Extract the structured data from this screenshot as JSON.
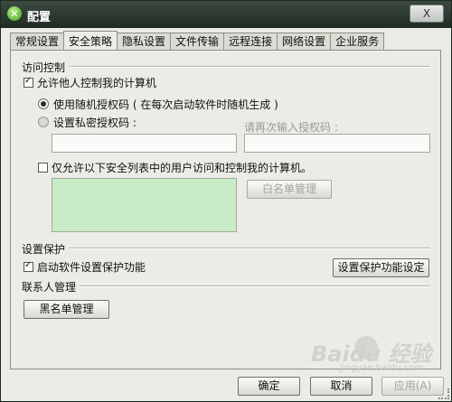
{
  "window": {
    "title": "配置",
    "close_label": "X"
  },
  "tabs": [
    {
      "label": "常规设置",
      "active": false
    },
    {
      "label": "安全策略",
      "active": true
    },
    {
      "label": "隐私设置",
      "active": false
    },
    {
      "label": "文件传输",
      "active": false
    },
    {
      "label": "远程连接",
      "active": false
    },
    {
      "label": "网络设置",
      "active": false
    },
    {
      "label": "企业服务",
      "active": false
    }
  ],
  "access_control": {
    "group_label": "访问控制",
    "allow_control": {
      "label": "允许他人控制我的计算机",
      "checked": true
    },
    "random_code": {
      "label": "使用随机授权码 ( 在每次启动软件时随机生成 )",
      "selected": true
    },
    "private_code": {
      "label": "设置私密授权码 :",
      "selected": false,
      "value": ""
    },
    "confirm_code": {
      "label": "请再次输入授权码 :",
      "value": ""
    },
    "whitelist_only": {
      "label": "仅允许以下安全列表中的用户访问和控制我的计算机。",
      "checked": false
    },
    "whitelist_button": "白名单管理"
  },
  "protection": {
    "group_label": "设置保护",
    "enable": {
      "label": "启动软件设置保护功能",
      "checked": true
    },
    "settings_button": "设置保护功能设定"
  },
  "contacts": {
    "group_label": "联系人管理",
    "blacklist_button": "黑名单管理"
  },
  "footer": {
    "ok_label": "确定",
    "cancel_label": "取消",
    "apply_label": "应用(A)"
  },
  "watermark": {
    "brand": "Baidu 经验",
    "url": "jingyan.baidu.com"
  }
}
